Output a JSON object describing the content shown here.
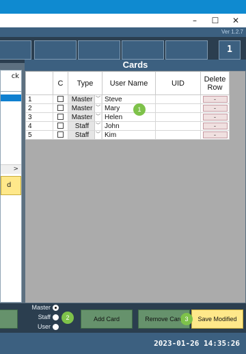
{
  "window": {
    "min": "–",
    "max": "☐",
    "close": "✕",
    "version": "Ver 1.2.7"
  },
  "tabs": {
    "page_indicator": "1"
  },
  "left_panel": {
    "header": "ck",
    "scroll_arrow": ">",
    "yellow_label": "d"
  },
  "cards": {
    "title": "Cards",
    "columns": [
      "",
      "C",
      "Type",
      "User Name",
      "UID",
      "Delete\nRow"
    ],
    "rows": [
      {
        "index": "1",
        "type": "Master",
        "user": "Steve",
        "uid": "",
        "delete": "-"
      },
      {
        "index": "2",
        "type": "Master",
        "user": "Mary",
        "uid": "",
        "delete": "-"
      },
      {
        "index": "3",
        "type": "Master",
        "user": "Helen",
        "uid": "",
        "delete": "-"
      },
      {
        "index": "4",
        "type": "Staff",
        "user": "John",
        "uid": "",
        "delete": "-"
      },
      {
        "index": "5",
        "type": "Staff",
        "user": "Kim",
        "uid": "",
        "delete": "-"
      }
    ]
  },
  "controls": {
    "radio": {
      "master": "Master",
      "staff": "Staff",
      "user": "User"
    },
    "add_card": "Add Card",
    "remove_card": "Remove Card",
    "save_modified": "Save Modified",
    "badges": [
      "1",
      "2",
      "3"
    ]
  },
  "status": {
    "datetime": "2023-01-26 14:35:26"
  }
}
